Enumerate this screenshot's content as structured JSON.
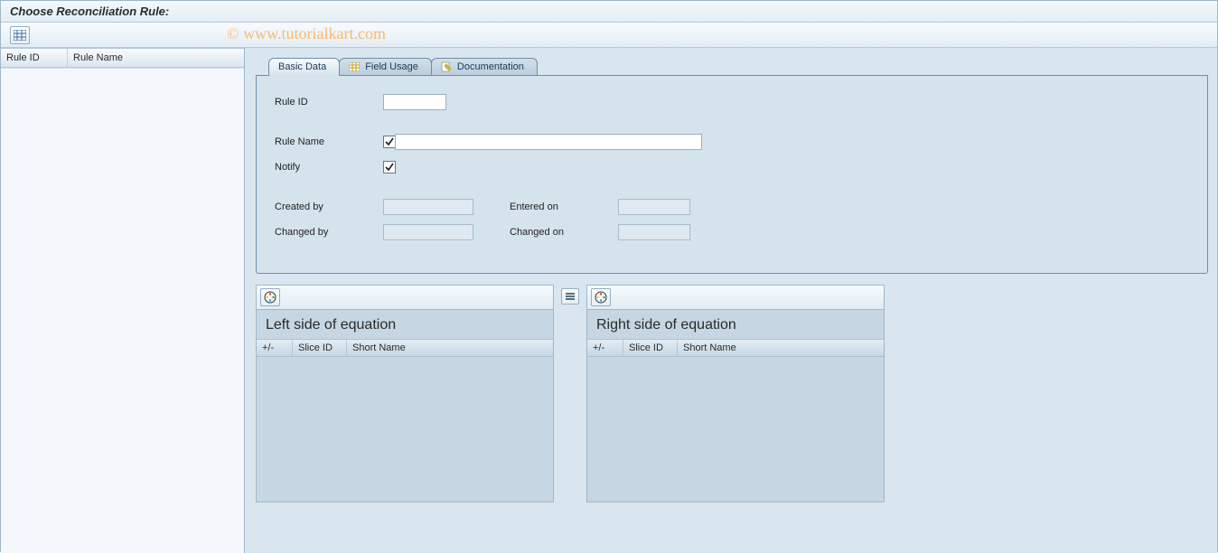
{
  "header": {
    "title": "Choose Reconciliation Rule:"
  },
  "watermark": "© www.tutorialkart.com",
  "sidebar": {
    "columns": [
      "Rule ID",
      "Rule Name"
    ]
  },
  "tabs": [
    {
      "label": "Basic Data",
      "selected": true
    },
    {
      "label": "Field Usage",
      "selected": false
    },
    {
      "label": "Documentation",
      "selected": false
    }
  ],
  "form": {
    "rule_id_label": "Rule ID",
    "rule_id_value": "",
    "rule_name_label": "Rule Name",
    "rule_name_checked": true,
    "rule_name_value": "",
    "notify_label": "Notify",
    "notify_checked": true,
    "created_by_label": "Created by",
    "created_by_value": "",
    "entered_on_label": "Entered on",
    "entered_on_value": "",
    "changed_by_label": "Changed by",
    "changed_by_value": "",
    "changed_on_label": "Changed on",
    "changed_on_value": ""
  },
  "left_eq": {
    "title": "Left side of equation",
    "columns": [
      "+/-",
      "Slice ID",
      "Short Name"
    ]
  },
  "right_eq": {
    "title": "Right side of equation",
    "columns": [
      "+/-",
      "Slice ID",
      "Short Name"
    ]
  }
}
